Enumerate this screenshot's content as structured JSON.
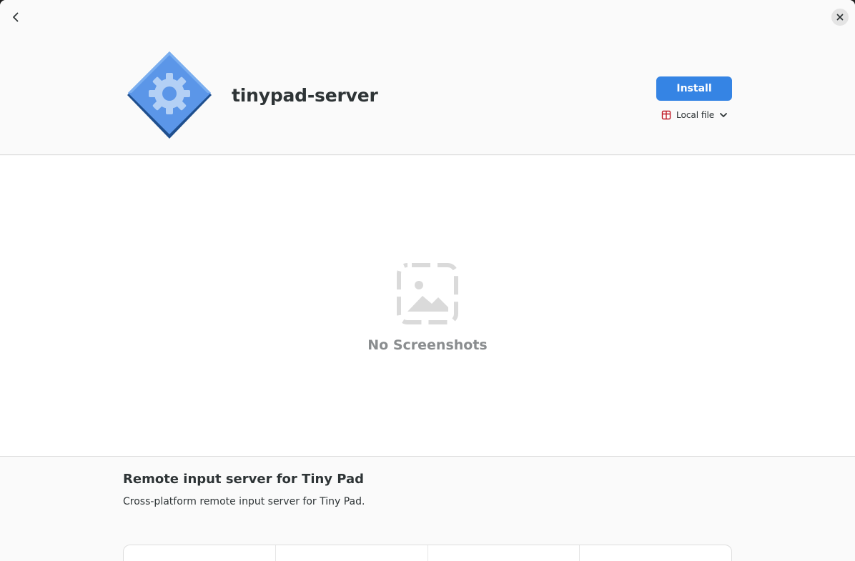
{
  "header": {
    "back_icon": "chevron-left-icon",
    "close_icon": "close-icon",
    "app_icon": "gear-diamond-app-icon",
    "app_name": "tinypad-server",
    "install_label": "Install",
    "source": {
      "icon": "package-icon",
      "label": "Local file",
      "dropdown_icon": "chevron-down-icon"
    }
  },
  "screenshots": {
    "icon": "image-placeholder-icon",
    "empty_label": "No Screenshots"
  },
  "details": {
    "summary": "Remote input server for Tiny Pad",
    "description": "Cross-platform remote input server for Tiny Pad."
  },
  "colors": {
    "accent": "#3584e4",
    "icon_blue": "#5b96e8",
    "icon_dark": "#1f4f8e",
    "package_red": "#c01c28"
  }
}
